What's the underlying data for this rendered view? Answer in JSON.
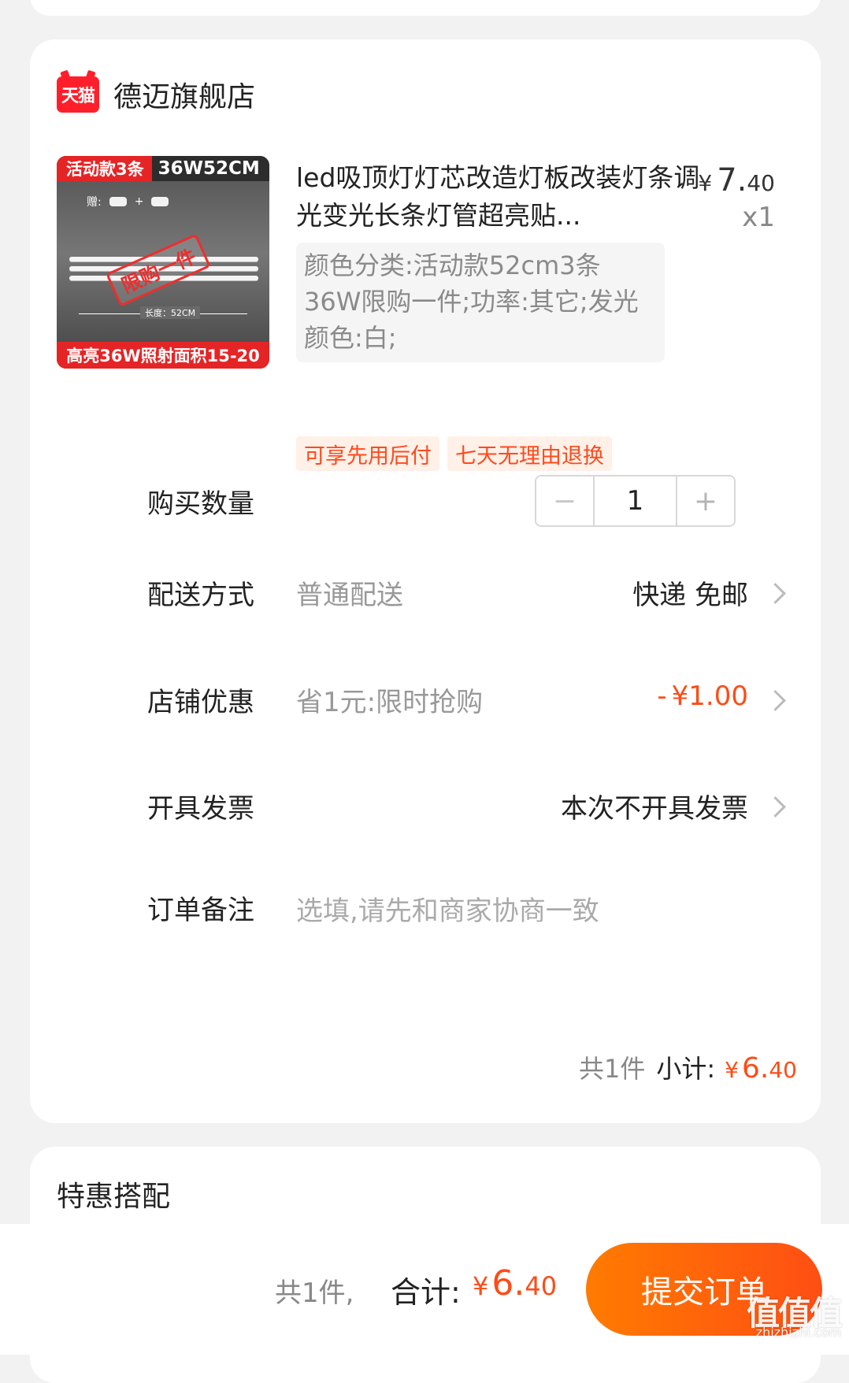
{
  "store": {
    "badge": "天猫",
    "name": "德迈旗舰店"
  },
  "product": {
    "image_top_left": "活动款3条",
    "image_top_right": "36W52CM",
    "image_gift": "赠:",
    "image_stamp": "限购一件",
    "image_length": "长度：52CM",
    "image_bottom": "高亮36W照射面积15-20",
    "title": "led吸顶灯灯芯改造灯板改装灯条调光变光长条灯管超亮贴...",
    "price_yen": "¥",
    "price_int": "7.",
    "price_dec": "40",
    "quantity_text": "x1",
    "sku": "颜色分类:活动款52cm3条36W限购一件;功率:其它;发光颜色:白;",
    "tags": [
      "可享先用后付",
      "七天无理由退换"
    ]
  },
  "rows": {
    "quantity_label": "购买数量",
    "quantity_minus": "−",
    "quantity_value": "1",
    "quantity_plus": "+",
    "delivery_label": "配送方式",
    "delivery_sub": "普通配送",
    "delivery_value": "快递 免邮",
    "discount_label": "店铺优惠",
    "discount_sub": "省1元:限时抢购",
    "discount_sign": "-",
    "discount_value": "¥1.00",
    "invoice_label": "开具发票",
    "invoice_value": "本次不开具发票",
    "remark_label": "订单备注",
    "remark_placeholder": "选填,请先和商家协商一致",
    "remark_value": ""
  },
  "summary": {
    "count": "共1件",
    "subtotal_label": "小计:",
    "subtotal_yen": "¥",
    "subtotal_int": "6.",
    "subtotal_dec": "40"
  },
  "special": {
    "title": "特惠搭配"
  },
  "bottom": {
    "count": "共1件,",
    "total_label": "合计:",
    "total_yen": "¥",
    "total_int": "6.",
    "total_dec": "40",
    "submit_label": "提交订单"
  },
  "watermark": {
    "logo": "值值值",
    "text": "zhizhizhi.com"
  },
  "colors": {
    "accent": "#ff4b17",
    "tmall_red": "#ff1f2b",
    "tag_bg": "#fff0e8"
  },
  "icons": {
    "store_badge": "tmall-logo-icon",
    "row_chevron": "chevron-right-icon"
  }
}
